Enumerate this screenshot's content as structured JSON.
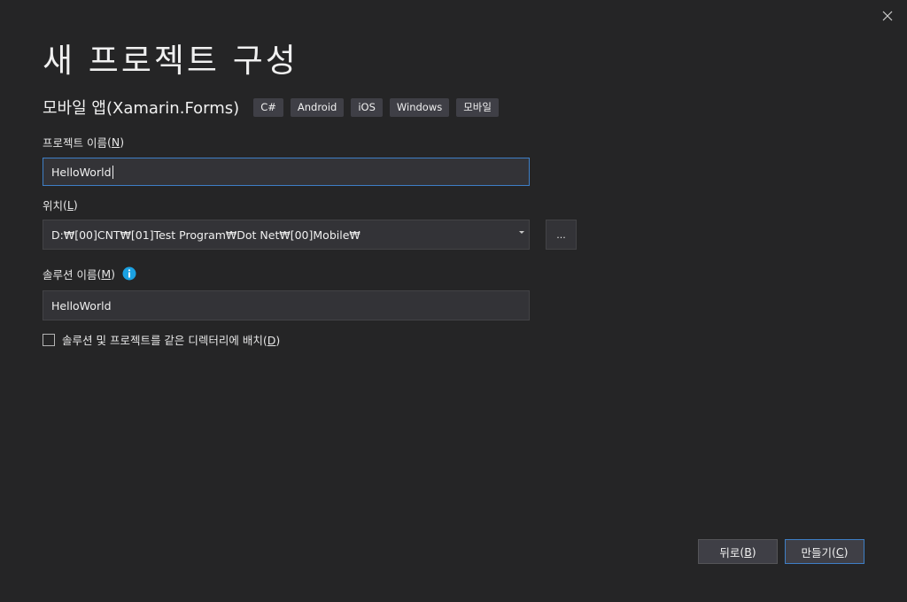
{
  "dialog": {
    "title": "새 프로젝트 구성"
  },
  "template": {
    "name": "모바일 앱(Xamarin.Forms)",
    "tags": [
      "C#",
      "Android",
      "iOS",
      "Windows",
      "모바일"
    ]
  },
  "project_name": {
    "label": "프로젝트 이름",
    "mnemonic": "N",
    "value": "HelloWorld"
  },
  "location": {
    "label": "위치",
    "mnemonic": "L",
    "value": "D:₩[00]CNT₩[01]Test Program₩Dot Net₩[00]Mobile₩",
    "browse_label": "..."
  },
  "solution_name": {
    "label": "솔루션 이름",
    "mnemonic": "M",
    "value": "HelloWorld"
  },
  "same_directory": {
    "label": "솔루션 및 프로젝트를 같은 디렉터리에 배치",
    "mnemonic": "D",
    "checked": false
  },
  "buttons": {
    "back_label": "뒤로",
    "back_mnemonic": "B",
    "create_label": "만들기",
    "create_mnemonic": "C"
  },
  "colors": {
    "background": "#252526",
    "input_bg": "#333337",
    "accent": "#3e7fc6",
    "info": "#1ba1e2"
  }
}
